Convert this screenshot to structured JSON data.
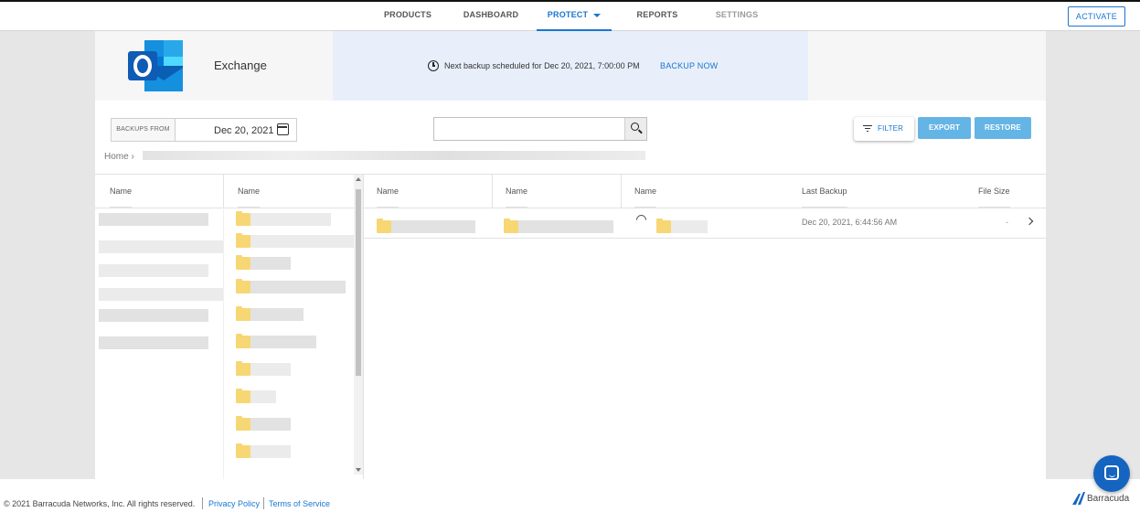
{
  "nav": {
    "items": [
      {
        "label": "PRODUCTS"
      },
      {
        "label": "DASHBOARD"
      },
      {
        "label": "PROTECT",
        "active": true
      },
      {
        "label": "REPORTS"
      },
      {
        "label": "SETTINGS",
        "muted": true
      }
    ],
    "activate_label": "ACTIVATE"
  },
  "header": {
    "app_icon": "outlook-icon",
    "app_name": "Exchange",
    "backup_schedule": "Next backup scheduled for Dec 20, 2021, 7:00:00 PM",
    "backup_now_label": "BACKUP NOW"
  },
  "toolbar": {
    "backups_from_label": "BACKUPS FROM",
    "date_value": "Dec 20, 2021",
    "search_placeholder": "",
    "filter_label": "FILTER",
    "export_label": "EXPORT",
    "restore_label": "RESTORE"
  },
  "breadcrumb": {
    "home": "Home",
    "separator": "›"
  },
  "columns": {
    "col1": "Name",
    "col2": "Name",
    "col3": "Name",
    "col4": "Name",
    "col5": "Name",
    "last_backup": "Last Backup",
    "file_size": "File Size"
  },
  "detail_row": {
    "last_backup": "Dec 20, 2021, 6:44:56 AM",
    "file_size": "-"
  },
  "footer": {
    "copyright": "© 2021 Barracuda Networks, Inc. All rights reserved.",
    "privacy_label": "Privacy Policy",
    "terms_label": "Terms of Service",
    "brand": "Barracuda"
  },
  "colors": {
    "accent": "#1976d2",
    "button": "#64b5e6",
    "backup_band": "#e8effb",
    "folder": "#f7d774"
  }
}
